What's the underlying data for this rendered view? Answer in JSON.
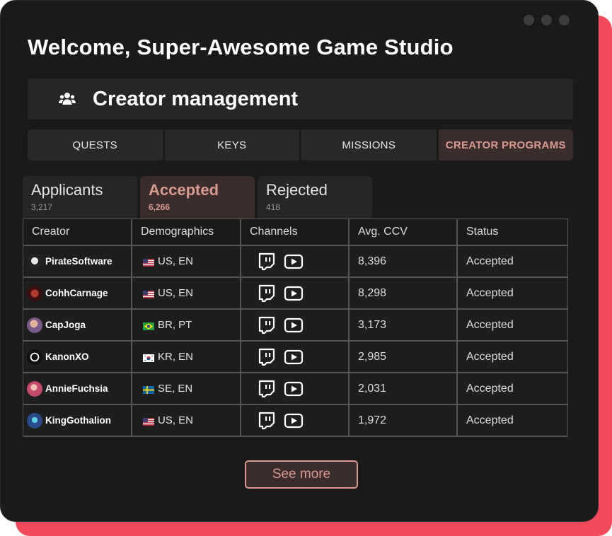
{
  "welcome_title": "Welcome, Super-Awesome Game Studio",
  "section": {
    "title": "Creator management",
    "icon": "users-icon"
  },
  "nav_tabs": [
    {
      "label": "QUESTS",
      "active": false
    },
    {
      "label": "KEYS",
      "active": false
    },
    {
      "label": "MISSIONS",
      "active": false
    },
    {
      "label": "CREATOR PROGRAMS",
      "active": true
    }
  ],
  "sub_tabs": [
    {
      "label": "Applicants",
      "count": "3,217",
      "active": false
    },
    {
      "label": "Accepted",
      "count": "6,266",
      "active": true
    },
    {
      "label": "Rejected",
      "count": "418",
      "active": false
    }
  ],
  "table": {
    "columns": [
      "Creator",
      "Demographics",
      "Channels",
      "Avg. CCV",
      "Status"
    ],
    "rows": [
      {
        "creator": "PirateSoftware",
        "flag": "US",
        "demographics": "US, EN",
        "channels": [
          "twitch-icon",
          "youtube-icon"
        ],
        "ccv": "8,396",
        "status": "Accepted"
      },
      {
        "creator": "CohhCarnage",
        "flag": "US",
        "demographics": "US, EN",
        "channels": [
          "twitch-icon",
          "youtube-icon"
        ],
        "ccv": "8,298",
        "status": "Accepted"
      },
      {
        "creator": "CapJoga",
        "flag": "BR",
        "demographics": "BR, PT",
        "channels": [
          "twitch-icon",
          "youtube-icon"
        ],
        "ccv": "3,173",
        "status": "Accepted"
      },
      {
        "creator": "KanonXO",
        "flag": "KR",
        "demographics": "KR, EN",
        "channels": [
          "twitch-icon",
          "youtube-icon"
        ],
        "ccv": "2,985",
        "status": "Accepted"
      },
      {
        "creator": "AnnieFuchsia",
        "flag": "SE",
        "demographics": "SE, EN",
        "channels": [
          "twitch-icon",
          "youtube-icon"
        ],
        "ccv": "2,031",
        "status": "Accepted"
      },
      {
        "creator": "KingGothalion",
        "flag": "US",
        "demographics": "US, EN",
        "channels": [
          "twitch-icon",
          "youtube-icon"
        ],
        "ccv": "1,972",
        "status": "Accepted"
      }
    ]
  },
  "see_more_label": "See more",
  "colors": {
    "background": "#1a1a1a",
    "accent": "#d99a90",
    "accent_bg": "#3a2d2c",
    "shadow": "#f24a5b"
  }
}
